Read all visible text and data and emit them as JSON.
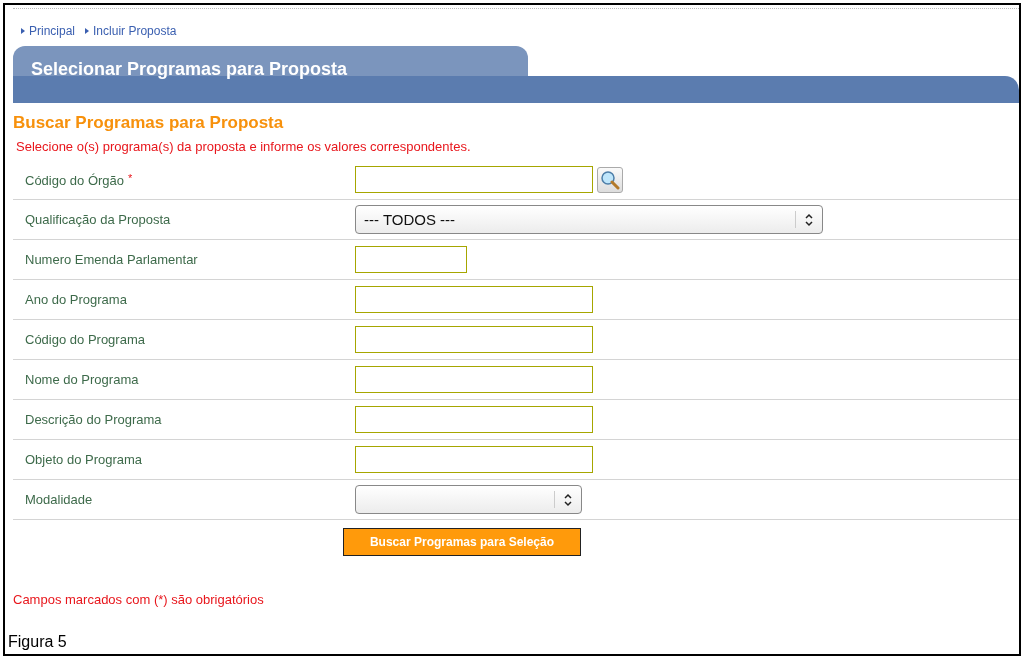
{
  "breadcrumb": [
    {
      "label": "Principal"
    },
    {
      "label": "Incluir Proposta"
    }
  ],
  "panel": {
    "title": "Selecionar Programas para Proposta"
  },
  "heading": "Buscar Programas para Proposta",
  "instruction": "Selecione o(s) programa(s) da proposta e informe os valores correspondentes.",
  "fields": [
    {
      "label": "Código do Órgão",
      "required": true,
      "required_mark": "*",
      "kind": "lookup"
    },
    {
      "label": "Qualificação da Proposta",
      "required": false,
      "kind": "select",
      "value": "--- TODOS ---"
    },
    {
      "label": "Numero Emenda Parlamentar",
      "required": false,
      "kind": "short"
    },
    {
      "label": "Ano do Programa",
      "required": false,
      "kind": "text"
    },
    {
      "label": "Código do Programa",
      "required": false,
      "kind": "text"
    },
    {
      "label": "Nome do Programa",
      "required": false,
      "kind": "text"
    },
    {
      "label": "Descrição do Programa",
      "required": false,
      "kind": "text"
    },
    {
      "label": "Objeto do Programa",
      "required": false,
      "kind": "text"
    },
    {
      "label": "Modalidade",
      "required": false,
      "kind": "compact-select"
    }
  ],
  "search_button": "Buscar Programas para Seleção",
  "required_note": "Campos marcados com (*) são obrigatórios",
  "caption": "Figura 5"
}
